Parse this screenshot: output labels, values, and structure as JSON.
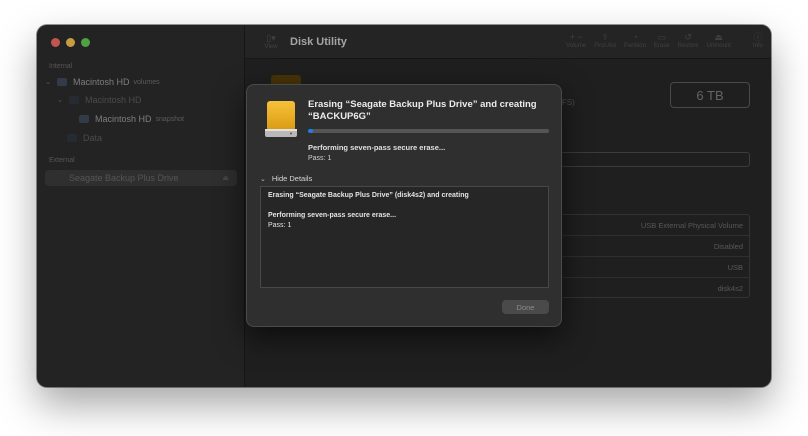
{
  "window": {
    "app_title": "Disk Utility"
  },
  "sidebar": {
    "internal_label": "Internal",
    "external_label": "External",
    "items": [
      {
        "label": "Macintosh HD",
        "sub": "volumes"
      },
      {
        "label": "Macintosh HD",
        "sub": ""
      },
      {
        "label": "Macintosh HD",
        "sub": "snapshot"
      },
      {
        "label": "Data",
        "sub": ""
      },
      {
        "label": "Seagate Backup Plus Drive",
        "sub": ""
      }
    ]
  },
  "toolbar": {
    "view_label": "View",
    "actions": [
      {
        "label": "Volume",
        "icon": "plus-minus-icon"
      },
      {
        "label": "First Aid",
        "icon": "stethoscope-icon"
      },
      {
        "label": "Partition",
        "icon": "pie-icon"
      },
      {
        "label": "Erase",
        "icon": "erase-icon"
      },
      {
        "label": "Restore",
        "icon": "restore-icon"
      },
      {
        "label": "Unmount",
        "icon": "eject-icon"
      },
      {
        "label": "Info",
        "icon": "info-icon"
      }
    ]
  },
  "detail": {
    "capacity": "6 TB",
    "fs_suffix": "TFS)",
    "info_rows": [
      "USB External Physical Volume",
      "Disabled",
      "USB",
      "disk4s2"
    ]
  },
  "sheet": {
    "title": "Erasing “Seagate Backup Plus Drive” and creating “BACKUP6G”",
    "progress": 0.02,
    "status": "Performing seven-pass secure erase...",
    "pass": "Pass: 1",
    "hide_details": "Hide Details",
    "log": [
      {
        "text": "Erasing “Seagate Backup Plus Drive” (disk4s2) and creating",
        "bold": true
      },
      {
        "text": "",
        "bold": false
      },
      {
        "text": "Performing seven-pass secure erase...",
        "bold": true
      },
      {
        "text": "Pass: 1",
        "bold": false
      }
    ],
    "done_label": "Done"
  },
  "colors": {
    "accent": "#1f7cf0",
    "drive": "#e8a921"
  }
}
